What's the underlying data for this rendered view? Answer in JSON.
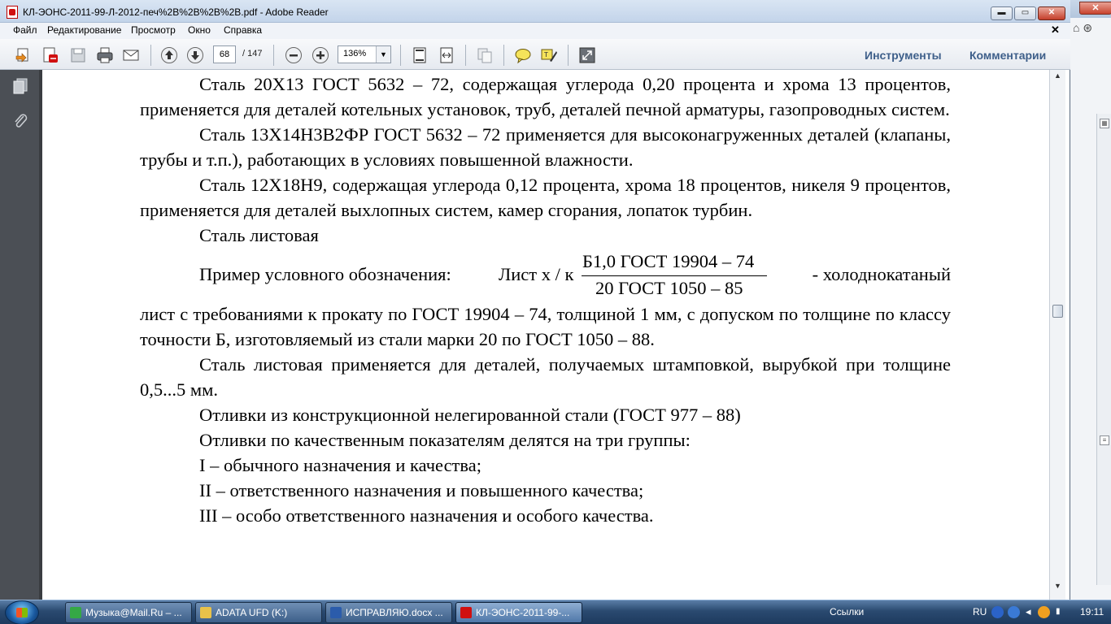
{
  "window": {
    "title": "КЛ-ЭОНС-2011-99-Л-2012-печ%2B%2B%2B%2B.pdf - Adobe Reader",
    "min_label": "▬",
    "max_label": "▭",
    "close_label": "✕"
  },
  "menu": {
    "items": [
      "Файл",
      "Редактирование",
      "Просмотр",
      "Окно",
      "Справка"
    ],
    "doc_close": "✕"
  },
  "toolbar": {
    "page_current": "68",
    "page_total": "/ 147",
    "zoom": "136%",
    "tools_label": "Инструменты",
    "comments_label": "Комментарии"
  },
  "document": {
    "p1": "Сталь 20Х13 ГОСТ 5632 – 72, содержащая углерода 0,20 процента и хрома 13 процентов, применяется для деталей котельных установок, труб, деталей печной арматуры, газопроводных систем.",
    "p2": "Сталь 13Х14Н3В2ФР ГОСТ 5632 – 72 применяется для высоконагруженных деталей (клапаны, трубы и т.п.), работающих в условиях повышенной влажности.",
    "p3": "Сталь 12Х18Н9, содержащая углерода 0,12 процента, хрома 18 процентов, никеля 9 процентов, применяется для деталей выхлопных систем, камер сгорания, лопаток турбин.",
    "p4": "Сталь листовая",
    "formula_label": "Пример условного обозначения:",
    "formula_lhs": "Лист х / к",
    "formula_num": "Б1,0 ГОСТ 19904 – 74",
    "formula_den": "20 ГОСТ 1050 – 85",
    "formula_rhs": "- холоднокатаный",
    "p5": "лист с требованиями к прокату по ГОСТ 19904 – 74, толщиной 1 мм, с допуском по толщине по классу точности Б, изготовляемый из стали марки 20 по ГОСТ 1050 – 88.",
    "p6": "Сталь листовая применяется для деталей, получаемых штамповкой, вырубкой при толщине 0,5...5 мм.",
    "p7": "Отливки из конструкционной нелегированной стали (ГОСТ 977 – 88)",
    "p8": "Отливки по качественным показателям делятся на три группы:",
    "p9": "I – обычного назначения и качества;",
    "p10": "II – ответственного назначения и повышенного качества;",
    "p11": "III – особо ответственного назначения и особого качества."
  },
  "taskbar": {
    "tasks": [
      "Музыка@Mail.Ru – ...",
      "ADATA UFD (K:)",
      "ИСПРАВЛЯЮ.docx ...",
      "КЛ-ЭОНС-2011-99-..."
    ],
    "links": "Ссылки",
    "lang": "RU",
    "time": "19:11"
  },
  "colors": {
    "accent": "#3e5f8a",
    "nav_pane": "#4b4f55",
    "pdf_red": "#d01010"
  },
  "icons": [
    "open-icon",
    "create-pdf-icon",
    "save-icon",
    "print-icon",
    "email-icon",
    "prev-page-icon",
    "next-page-icon",
    "zoom-out-icon",
    "zoom-in-icon",
    "fit-page-icon",
    "fit-width-icon",
    "select-icon",
    "comment-icon",
    "highlight-icon",
    "fullscreen-icon",
    "pages-icon",
    "attachments-icon"
  ]
}
